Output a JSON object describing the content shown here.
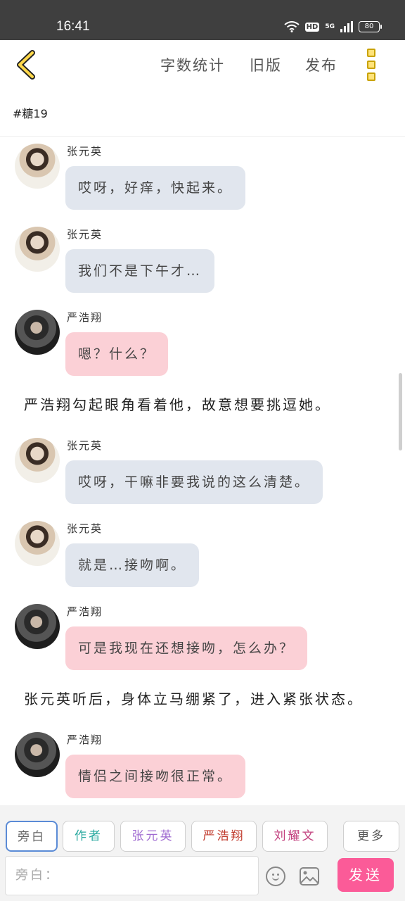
{
  "status_bar": {
    "time": "16:41",
    "network": "5G",
    "hd": "HD",
    "battery": "80"
  },
  "header": {
    "links": [
      "字数统计",
      "旧版",
      "发布"
    ]
  },
  "subtitle": "#糖19",
  "chat": [
    {
      "kind": "msg",
      "speaker": "张元英",
      "avatar": "zyy",
      "style": "blue",
      "text": "哎呀，好痒，快起来。"
    },
    {
      "kind": "msg",
      "speaker": "张元英",
      "avatar": "zyy",
      "style": "blue",
      "text": "我们不是下午才…"
    },
    {
      "kind": "msg",
      "speaker": "严浩翔",
      "avatar": "yhx",
      "style": "pink",
      "text": "嗯？什么？"
    },
    {
      "kind": "narration",
      "text": "严浩翔勾起眼角看着他，故意想要挑逗她。"
    },
    {
      "kind": "msg",
      "speaker": "张元英",
      "avatar": "zyy",
      "style": "blue",
      "text": "哎呀，干嘛非要我说的这么清楚。"
    },
    {
      "kind": "msg",
      "speaker": "张元英",
      "avatar": "zyy",
      "style": "blue",
      "text": "就是…接吻啊。"
    },
    {
      "kind": "msg",
      "speaker": "严浩翔",
      "avatar": "yhx",
      "style": "pink",
      "text": "可是我现在还想接吻，怎么办？"
    },
    {
      "kind": "narration",
      "text": "张元英听后，身体立马绷紧了，进入紧张状态。"
    },
    {
      "kind": "msg",
      "speaker": "严浩翔",
      "avatar": "yhx",
      "style": "pink",
      "text": "情侣之间接吻很正常。"
    }
  ],
  "roles": [
    {
      "label": "旁白",
      "color": "#666666",
      "active": true
    },
    {
      "label": "作者",
      "color": "#2aa9a0",
      "active": false
    },
    {
      "label": "张元英",
      "color": "#a06bd1",
      "active": false
    },
    {
      "label": "严浩翔",
      "color": "#c0392b",
      "active": false
    },
    {
      "label": "刘耀文",
      "color": "#c2407e",
      "active": false
    },
    {
      "label": "更多",
      "color": "#555555",
      "active": false
    }
  ],
  "input": {
    "placeholder": "旁白："
  },
  "send_label": "发送",
  "colors": {
    "send": "#fb5b98",
    "bubble_blue": "#e1e6ee",
    "bubble_pink": "#fbd0d6"
  }
}
